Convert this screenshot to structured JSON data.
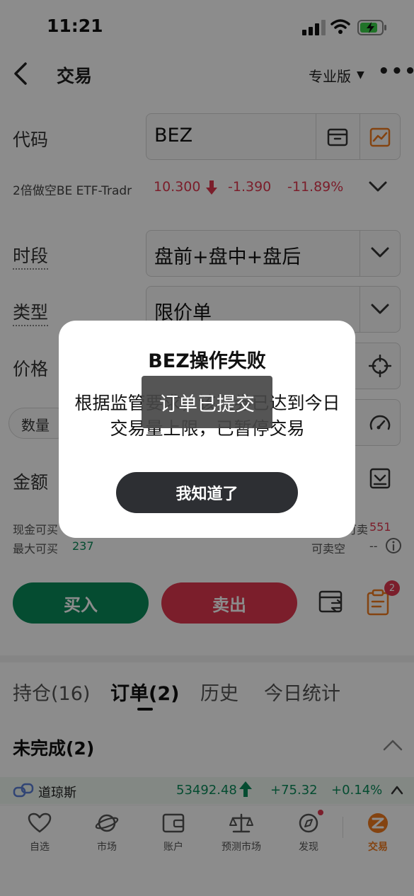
{
  "status_bar": {
    "time": "11:21"
  },
  "nav": {
    "title": "交易",
    "pro_label": "专业版"
  },
  "form": {
    "code_label": "代码",
    "code_value": "BEZ",
    "stock_name": "2倍做空BE ETF-Tradr",
    "price": "10.300",
    "change": "-1.390",
    "change_pct": "-11.89%",
    "session_label": "时段",
    "session_value": "盘前+盘中+盘后",
    "type_label": "类型",
    "type_value": "限价单",
    "price_label": "价格",
    "qty_label": "数量",
    "amount_label": "金额",
    "cash_buy_label": "现金可买",
    "max_buy_label": "最大可买",
    "max_buy_value": "237",
    "sellable_label": "可卖",
    "sellable_value": "551",
    "short_label": "可卖空",
    "short_value": "--"
  },
  "actions": {
    "buy_label": "买入",
    "sell_label": "卖出",
    "badge_count": "2"
  },
  "tabs": {
    "positions": "持仓(16)",
    "orders": "订单(2)",
    "history": "历史",
    "today_stats": "今日统计"
  },
  "orders_section": {
    "title": "未完成(2)"
  },
  "ticker": {
    "name": "道琼斯",
    "value": "53492.48",
    "change": "+75.32",
    "change_pct": "+0.14%"
  },
  "bottom_nav": [
    {
      "label": "自选"
    },
    {
      "label": "市场"
    },
    {
      "label": "账户"
    },
    {
      "label": "预测市场"
    },
    {
      "label": "发现"
    },
    {
      "label": "交易"
    }
  ],
  "dialog": {
    "title": "BEZ操作失败",
    "message": "根据监管要求，该证券已达到今日交易量上限，已暂停交易",
    "button_label": "我知道了"
  },
  "toast": {
    "text": "订单已提交"
  },
  "colors": {
    "buy": "#0a8a5a",
    "sell": "#e0384f",
    "accent": "#f07a1e"
  }
}
